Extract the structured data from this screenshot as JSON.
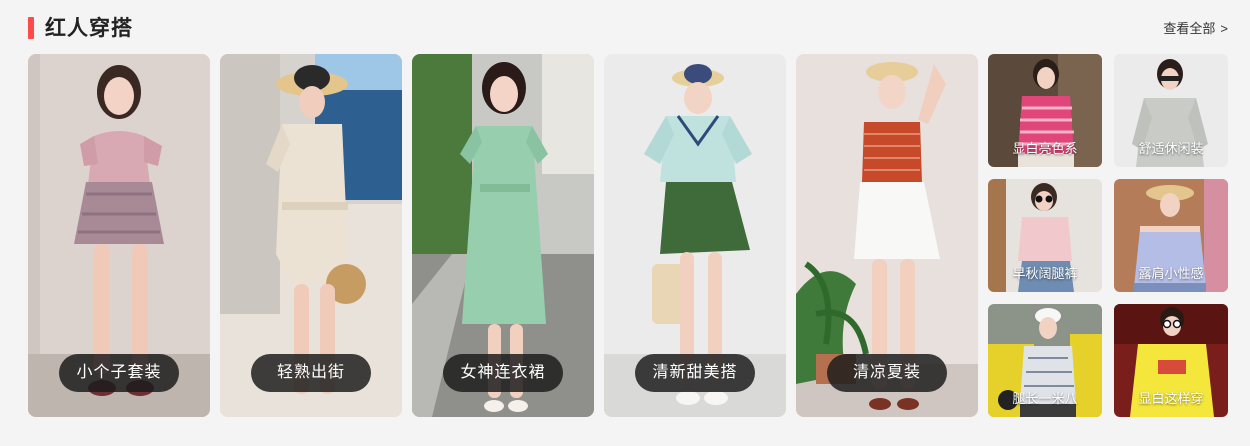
{
  "section": {
    "title": "红人穿搭",
    "more_label": "查看全部",
    "more_arrow": ">",
    "accent_color": "#ff4a4a"
  },
  "featured_cards": [
    {
      "label": "小个子套装",
      "icon": "photo-girl-pink-top-plaid-skirt"
    },
    {
      "label": "轻熟出街",
      "icon": "photo-girl-beige-dress-seaside"
    },
    {
      "label": "女神连衣裙",
      "icon": "photo-girl-green-dress-street"
    },
    {
      "label": "清新甜美搭",
      "icon": "photo-girl-mint-top-green-shorts"
    },
    {
      "label": "清凉夏装",
      "icon": "photo-girl-red-top-white-shorts"
    }
  ],
  "small_tiles": [
    {
      "label": "显白亮色系",
      "icon": "photo-girl-pink-striped-top"
    },
    {
      "label": "舒适休闲装",
      "icon": "photo-girl-grey-hoodie"
    },
    {
      "label": "早秋阔腿裤",
      "icon": "photo-girl-pink-top-jeans"
    },
    {
      "label": "露肩小性感",
      "icon": "photo-girl-off-shoulder-top"
    },
    {
      "label": "腿长一米八",
      "icon": "photo-girl-white-cap-yellow-car"
    },
    {
      "label": "显白这样穿",
      "icon": "photo-girl-yellow-sweater"
    }
  ]
}
